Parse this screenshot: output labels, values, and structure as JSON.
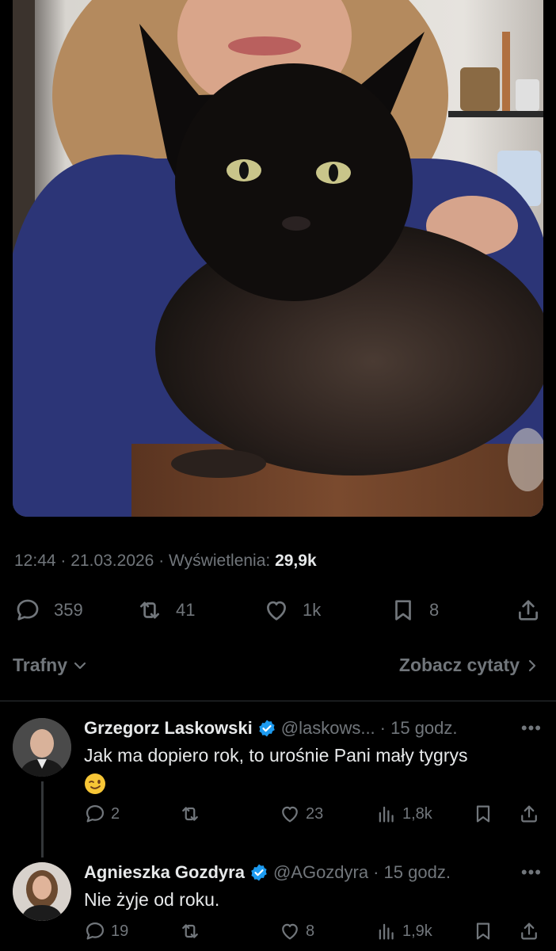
{
  "tweet": {
    "time": "12:44",
    "date": "21.03.2026",
    "views_label": "Wyświetlenia:",
    "views_count": "29,9k",
    "separator": "·",
    "actions": {
      "replies": "359",
      "reposts": "41",
      "likes": "1k",
      "bookmarks": "8"
    }
  },
  "sort": {
    "label": "Trafny",
    "quotes_link": "Zobacz cytaty"
  },
  "replies": [
    {
      "name": "Grzegorz Laskowski",
      "handle": "@laskows...",
      "time": "· 15 godz.",
      "text": "Jak ma dopiero rok, to urośnie Pani mały tygrys",
      "emoji": "winking-face",
      "replies": "2",
      "reposts": "",
      "likes": "23",
      "views": "1,8k"
    },
    {
      "name": "Agnieszka Gozdyra",
      "handle": "@AGozdyra",
      "time": "· 15 godz.",
      "text": "Nie żyje od roku.",
      "replies": "19",
      "reposts": "",
      "likes": "8",
      "views": "1,9k"
    }
  ],
  "icons": {
    "reply": "speech-bubble-icon",
    "repost": "repost-arrows-icon",
    "like": "heart-icon",
    "bookmark": "bookmark-icon",
    "share": "share-upload-icon",
    "views": "bar-chart-icon",
    "verified": "verified-badge-icon",
    "more": "more-dots-icon"
  },
  "colors": {
    "background": "#000000",
    "text": "#e7e9ea",
    "muted": "#71767b",
    "verified": "#1d9bf0"
  }
}
